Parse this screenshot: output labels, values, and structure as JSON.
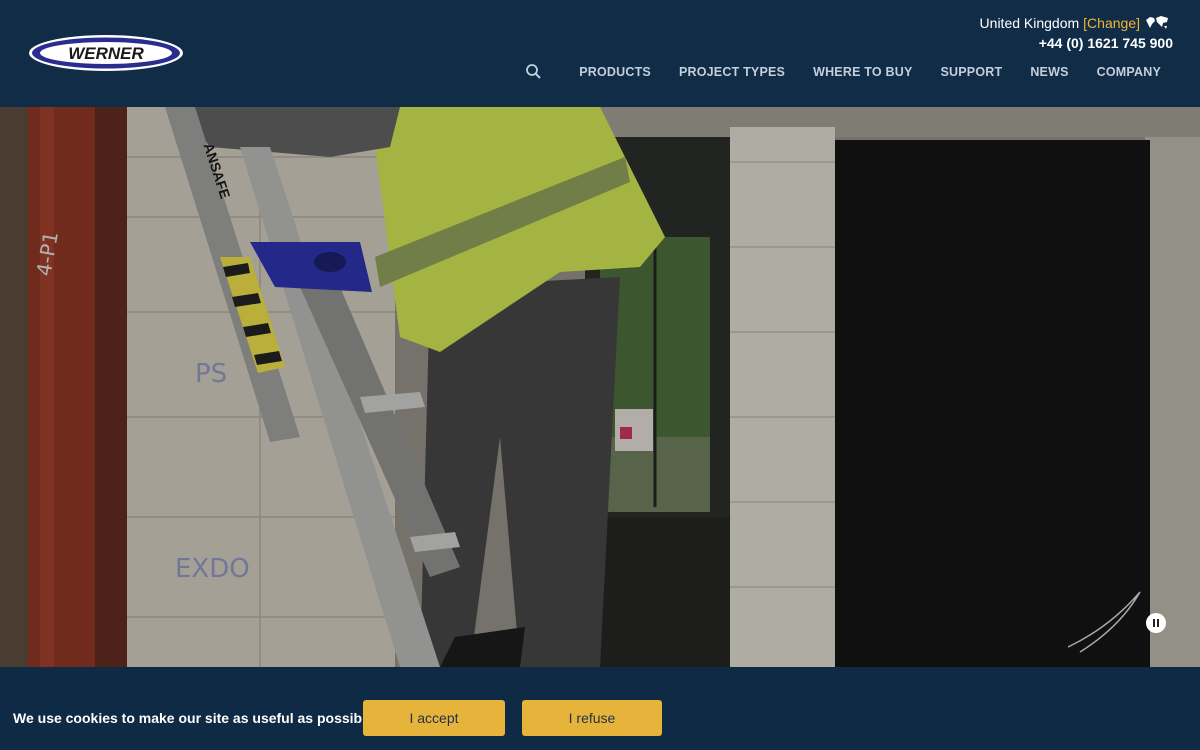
{
  "header": {
    "logo_text": "WERNER",
    "locale": {
      "country": "United Kingdom",
      "change_label": "[Change]",
      "icon": "globe-icon"
    },
    "phone": "+44 (0) 1621 745 900",
    "search_icon": "search-icon",
    "nav": [
      "PRODUCTS",
      "PROJECT TYPES",
      "WHERE TO BUY",
      "SUPPORT",
      "NEWS",
      "COMPANY"
    ]
  },
  "hero": {
    "ladder_label": "ANSAFE",
    "wall_markings": [
      "4-P1",
      "PS",
      "EXDO"
    ],
    "control": "pause-icon"
  },
  "cookie": {
    "message": "We use cookies to make our site as useful as possible.",
    "accept_label": "I accept",
    "refuse_label": "I refuse"
  },
  "colors": {
    "header_bg": "#102c47",
    "accent": "#f2b533",
    "button": "#e6b43a",
    "logo_blue": "#2a2c8f"
  }
}
